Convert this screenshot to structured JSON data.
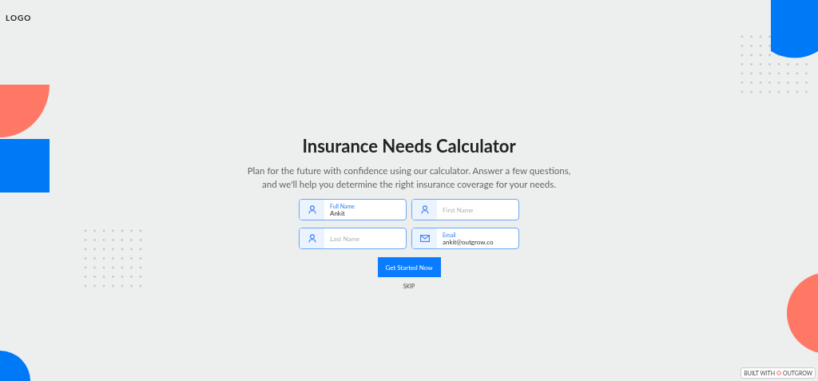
{
  "logo": "LOGO",
  "title": "Insurance Needs Calculator",
  "subtitle": "Plan for the future with confidence using our calculator. Answer a few questions, and we'll help you determine the right insurance coverage for your needs.",
  "fields": [
    {
      "kind": "person",
      "label": "Full Name",
      "value": "Ankit"
    },
    {
      "kind": "person",
      "placeholder": "First Name"
    },
    {
      "kind": "person",
      "placeholder": "Last Name"
    },
    {
      "kind": "mail",
      "label": "Email",
      "value": "ankit@outgrow.co"
    }
  ],
  "button": "Get Started Now",
  "skip": "SKIP",
  "badge": {
    "prefix": "BUILT WITH",
    "brand": "OUTGROW"
  }
}
